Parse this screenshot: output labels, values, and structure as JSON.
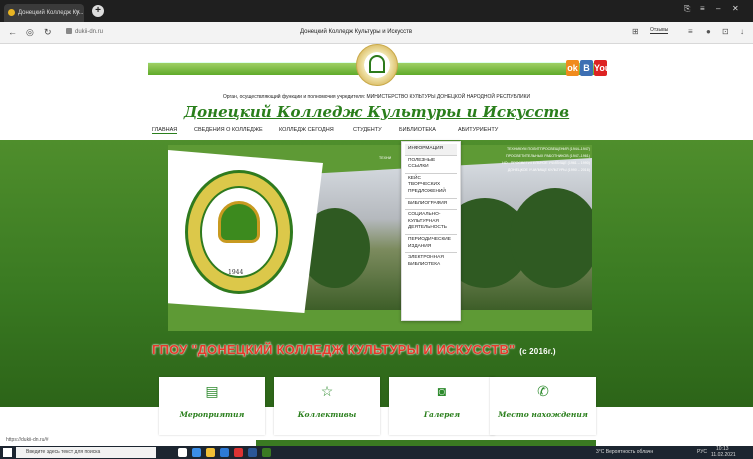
{
  "browser": {
    "tab_title": "Донецкий Колледж Ку...",
    "tab_close": "×",
    "new_tab": "+",
    "url": "dukii-dn.ru",
    "page_title": "Донецкий Колледж Культуры и Искусств",
    "reviews_label": "Отзывы",
    "status_url": "https://dukii-dn.ru/#"
  },
  "header": {
    "org_line": "Орган, осуществляющий функции и полномочия учредителя: МИНИСТЕРСТВО КУЛЬТУРЫ ДОНЕЦКОЙ НАРОДНОЙ РЕСПУБЛИКИ",
    "site_title": "Донецкий Колледж Культуры и Искусств",
    "social": [
      "ok",
      "B",
      "You"
    ]
  },
  "nav": {
    "items": [
      {
        "label": "ГЛАВНАЯ"
      },
      {
        "label": "СВЕДЕНИЯ О КОЛЛЕДЖЕ"
      },
      {
        "label": "КОЛЛЕДЖ СЕГОДНЯ"
      },
      {
        "label": "СТУДЕНТУ"
      },
      {
        "label": "БИБЛИОТЕКА"
      },
      {
        "label": "АБИТУРИЕНТУ"
      }
    ]
  },
  "dropdown": {
    "items": [
      {
        "label": "ИНФОРМАЦИЯ"
      },
      {
        "label": "ПОЛЕЗНЫЕ ССЫЛКИ"
      },
      {
        "label": "КЕЙС ТВОРЧЕСКИХ ПРЕДЛОЖЕНИЙ"
      },
      {
        "label": "БИБЛИОГРАФИЯ"
      },
      {
        "label": "СОЦИАЛЬНО-КУЛЬТУРНАЯ ДЕЯТЕЛЬНОСТЬ"
      },
      {
        "label": "ПЕРИОДИЧЕСКИЕ ИЗДАНИЯ"
      },
      {
        "label": "ЭЛЕКТРОННАЯ БИБЛИОТЕКА"
      }
    ]
  },
  "slider": {
    "tech_prefix": "ТЕХНИ",
    "history": [
      "ТЕХНИКУМ ПОЛИТПРОСВЕЩЕНИЯ (1944–1947)",
      "ПРОСВЕТИТЕЛЬНЫХ РАБОТНИКОВ (1947–1961)",
      "НО - ПРОСВЕТИТЕЛЬНОЕ УЧИЛИЩЕ (1961 – 1990)",
      "ДОНЕЦКОЕ УЧИЛИЩЕ КУЛЬТУРЫ (1990 – 2016)"
    ],
    "seal_text": "Донецкий колледж культуры и искусств",
    "seal_year": "1944",
    "title": "ГПОУ \"ДОНЕЦКИЙ КОЛЛЕДЖ КУЛЬТУРЫ И ИСКУССТВ\"",
    "title_year": "(с 2016г.)"
  },
  "cards": [
    {
      "label": "Мероприятия",
      "icon": "calendar-icon",
      "glyph": "▤"
    },
    {
      "label": "Коллективы",
      "icon": "star-icon",
      "glyph": "☆"
    },
    {
      "label": "Галерея",
      "icon": "camera-icon",
      "glyph": "◙"
    },
    {
      "label": "Место нахождения",
      "icon": "phone-icon",
      "glyph": "✆"
    }
  ],
  "taskbar": {
    "search_placeholder": "Введите здесь текст для поиска",
    "weather": "3°C Вероятность облачн",
    "lang": "РУС",
    "time": "10:13",
    "date": "11.02.2021"
  },
  "colors": {
    "brand_green": "#2a7f1c",
    "title_red": "#e53a2a"
  }
}
